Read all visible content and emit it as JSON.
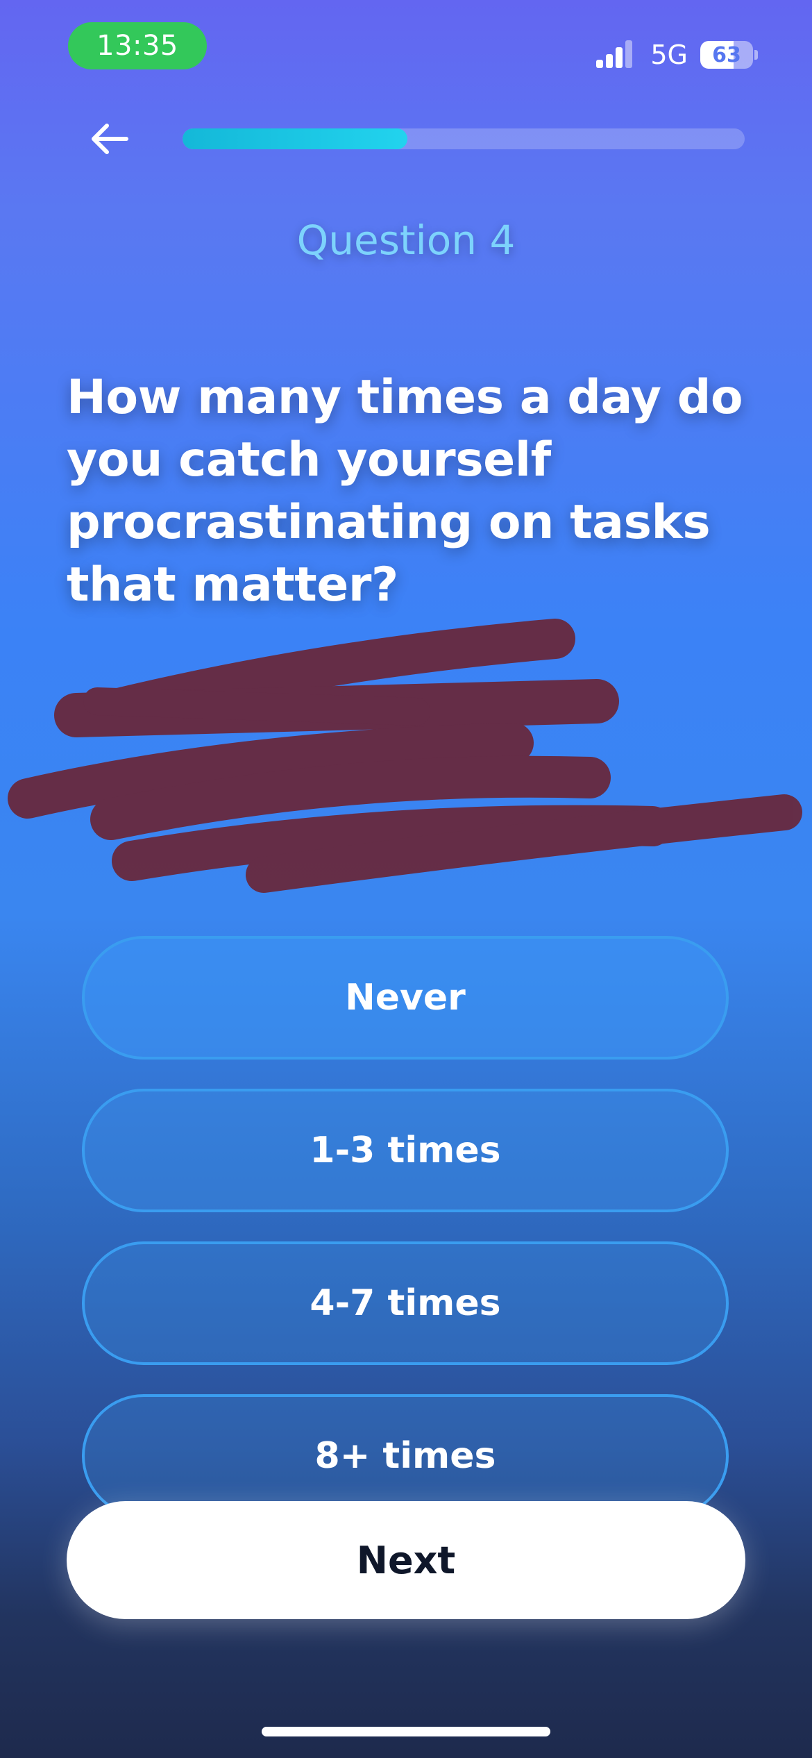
{
  "status_bar": {
    "time": "13:35",
    "network": "5G",
    "battery_level": "63",
    "battery_fraction": 0.63
  },
  "header": {
    "back_icon": "arrow-left-icon",
    "progress_fraction": 0.4
  },
  "question": {
    "number_label": "Question 4",
    "text": "How many times a day do you catch yourself procrastinating on tasks that matter?"
  },
  "options": [
    {
      "label": "Never"
    },
    {
      "label": "1-3 times"
    },
    {
      "label": "4-7 times"
    },
    {
      "label": "8+ times"
    }
  ],
  "next_button": {
    "label": "Next"
  },
  "colors": {
    "accent": "#22d3ee",
    "question_number": "#7dd3fc",
    "time_pill": "#33c85a",
    "redaction": "#6b2230"
  }
}
